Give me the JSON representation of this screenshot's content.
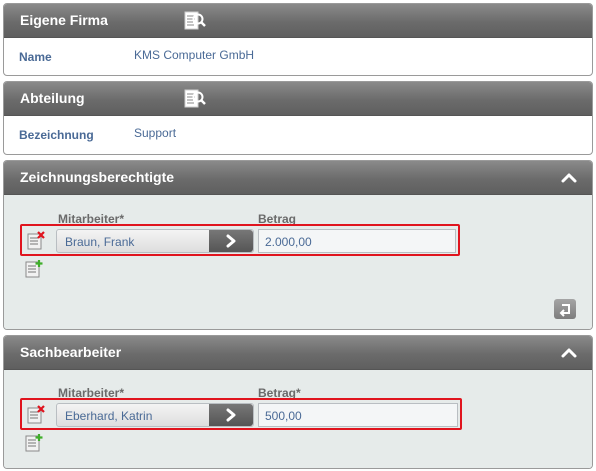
{
  "eigene_firma": {
    "title": "Eigene Firma",
    "lookup_icon": "lookup-document-icon",
    "field_label": "Name",
    "field_value": "KMS Computer GmbH"
  },
  "abteilung": {
    "title": "Abteilung",
    "lookup_icon": "lookup-document-icon",
    "field_label": "Bezeichnung",
    "field_value": "Support"
  },
  "zeichnungsberechtigte": {
    "title": "Zeichnungsberechtigte",
    "col_mitarbeiter": "Mitarbeiter*",
    "col_betrag": "Betrag",
    "rows": [
      {
        "mitarbeiter": "Braun, Frank",
        "betrag": "2.000,00"
      }
    ]
  },
  "sachbearbeiter": {
    "title": "Sachbearbeiter",
    "col_mitarbeiter": "Mitarbeiter*",
    "col_betrag": "Betrag*",
    "rows": [
      {
        "mitarbeiter": "Eberhard, Katrin",
        "betrag": "500,00"
      }
    ]
  },
  "icons": {
    "delete_row": "delete-row-icon",
    "add_row": "add-row-icon",
    "select": "chevron-right-icon",
    "collapse": "chevron-up-icon",
    "undo": "undo-icon"
  },
  "colors": {
    "header_bg": "#6b6b6b",
    "link_text": "#4a6a96",
    "highlight": "#e0141e",
    "section_bg": "#e6ebea"
  }
}
